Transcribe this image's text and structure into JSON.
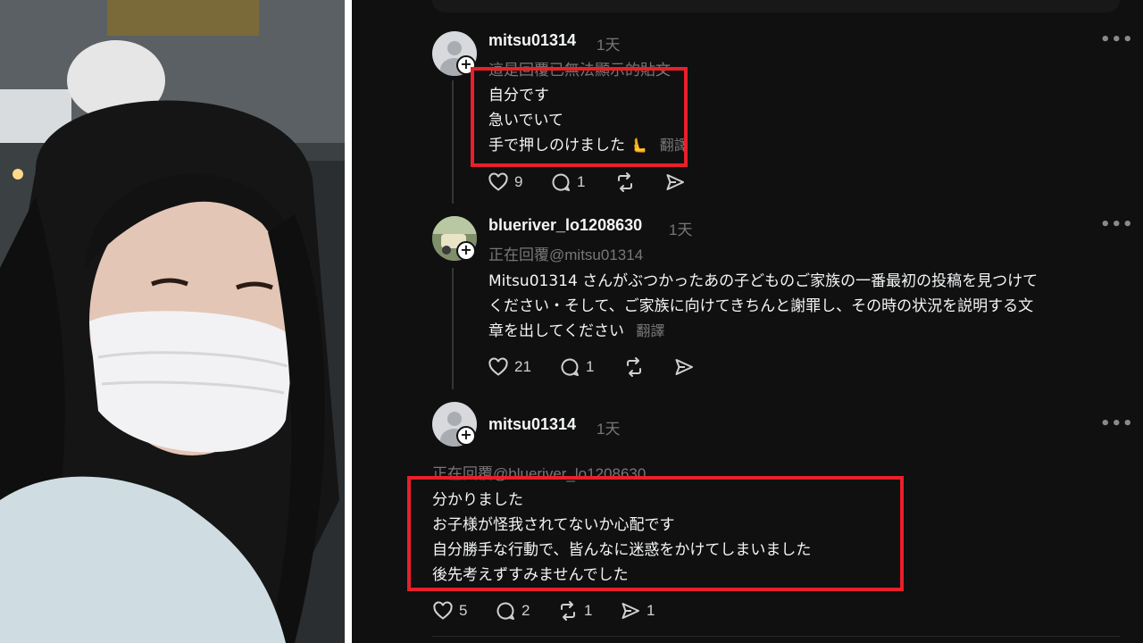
{
  "comments": [
    {
      "username": "mitsu01314",
      "time": "1天",
      "hidden_notice": "這是回覆已無法顯示的貼文",
      "lines": [
        "自分です",
        "急いでいて",
        "手で押しのけました"
      ],
      "emoji": "🫷",
      "translate": "翻譯",
      "likes": "9",
      "replies": "1"
    },
    {
      "username": "blueriver_lo1208630",
      "time": "1天",
      "reply_to": "正在回覆@mitsu01314",
      "lines": [
        "Mitsu01314 さんがぶつかったあの子どものご家族の一番最初の投稿を見つけて",
        "ください・そして、ご家族に向けてきちんと謝罪し、その時の状況を説明する文",
        "章を出してください"
      ],
      "translate": "翻譯",
      "likes": "21",
      "replies": "1"
    },
    {
      "username": "mitsu01314",
      "time": "1天",
      "reply_to": "正在回覆@blueriver_lo1208630",
      "lines": [
        "分かりました",
        "お子様が怪我されてないか心配です",
        "自分勝手な行動で、皆んなに迷惑をかけてしまいました",
        "後先考えずすみませんでした"
      ],
      "likes": "5",
      "replies": "2",
      "reposts": "1",
      "shares": "1"
    }
  ],
  "colors": {
    "background": "#101010",
    "highlight": "#e8202a",
    "muted": "#777777"
  },
  "icons": [
    "heart-icon",
    "comment-icon",
    "repost-icon",
    "share-icon",
    "more-icon",
    "plus-icon"
  ]
}
